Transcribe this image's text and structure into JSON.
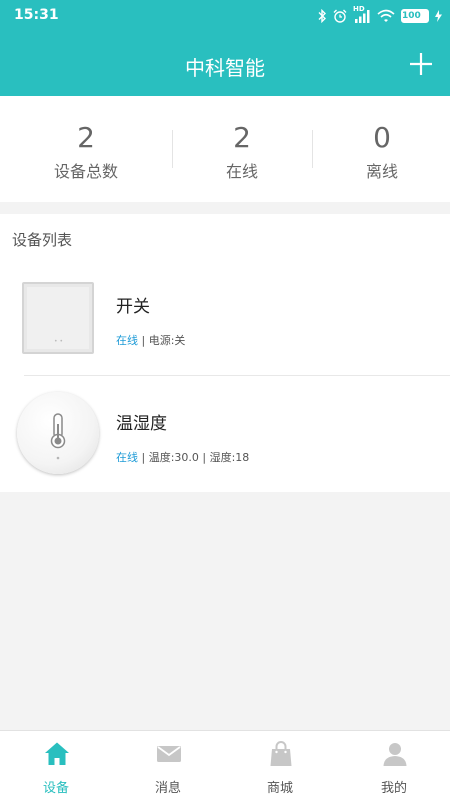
{
  "statusbar": {
    "time": "15:31",
    "battery": "100",
    "hd": "HD"
  },
  "header": {
    "title": "中科智能",
    "add_icon": "plus-icon"
  },
  "stats": [
    {
      "value": "2",
      "label": "设备总数"
    },
    {
      "value": "2",
      "label": "在线"
    },
    {
      "value": "0",
      "label": "离线"
    }
  ],
  "device_list": {
    "title": "设备列表",
    "items": [
      {
        "name": "开关",
        "online": "在线",
        "detail": " | 电源:关",
        "icon": "wall-switch-icon"
      },
      {
        "name": "温湿度",
        "online": "在线",
        "detail": " | 温度:30.0 | 湿度:18",
        "icon": "thermometer-sensor-icon"
      }
    ]
  },
  "tabs": [
    {
      "label": "设备",
      "icon": "home-icon",
      "active": true
    },
    {
      "label": "消息",
      "icon": "mail-icon",
      "active": false
    },
    {
      "label": "商城",
      "icon": "shopping-bag-icon",
      "active": false
    },
    {
      "label": "我的",
      "icon": "person-icon",
      "active": false
    }
  ],
  "colors": {
    "accent": "#29bfbf",
    "online": "#1e9bd7",
    "inactive_icon": "#c7c7c7"
  }
}
